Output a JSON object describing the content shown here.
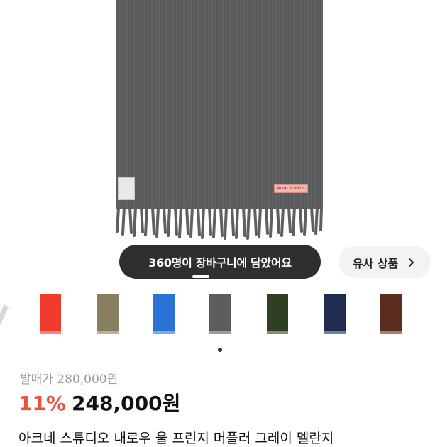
{
  "hero": {
    "image_label": "acne-studios-scarf-grey",
    "tag_text": "Acne Studios",
    "cart_notice": "360명이 장바구니에 담았어요",
    "similar_button": "유사 상품",
    "similar_icon": "chevron-right-icon"
  },
  "thumbnails": [
    {
      "name": "partial-grey",
      "color": "#d7d7d7"
    },
    {
      "name": "red",
      "color": "#ee3b2b"
    },
    {
      "name": "olive",
      "color": "#8a7e60"
    },
    {
      "name": "blue",
      "color": "#2a72d6"
    },
    {
      "name": "grey",
      "color": "#5b5d5e"
    },
    {
      "name": "forest-green",
      "color": "#2e3f24"
    },
    {
      "name": "navy",
      "color": "#1f2b4f"
    },
    {
      "name": "brown",
      "color": "#5a2d1f"
    },
    {
      "name": "partial-light-blue",
      "color": "#6d93b6"
    }
  ],
  "product": {
    "original_price": "발매가 280,000원",
    "discount": "11%",
    "price": "248,000원",
    "name": "아크네 스튜디오 내로우 울 프린지 머플러 그레이 멜란지"
  },
  "colors": {
    "accent_red": "#e8523e",
    "pill_dark": "#2f2f30",
    "grey_text": "#9a9a9a"
  }
}
